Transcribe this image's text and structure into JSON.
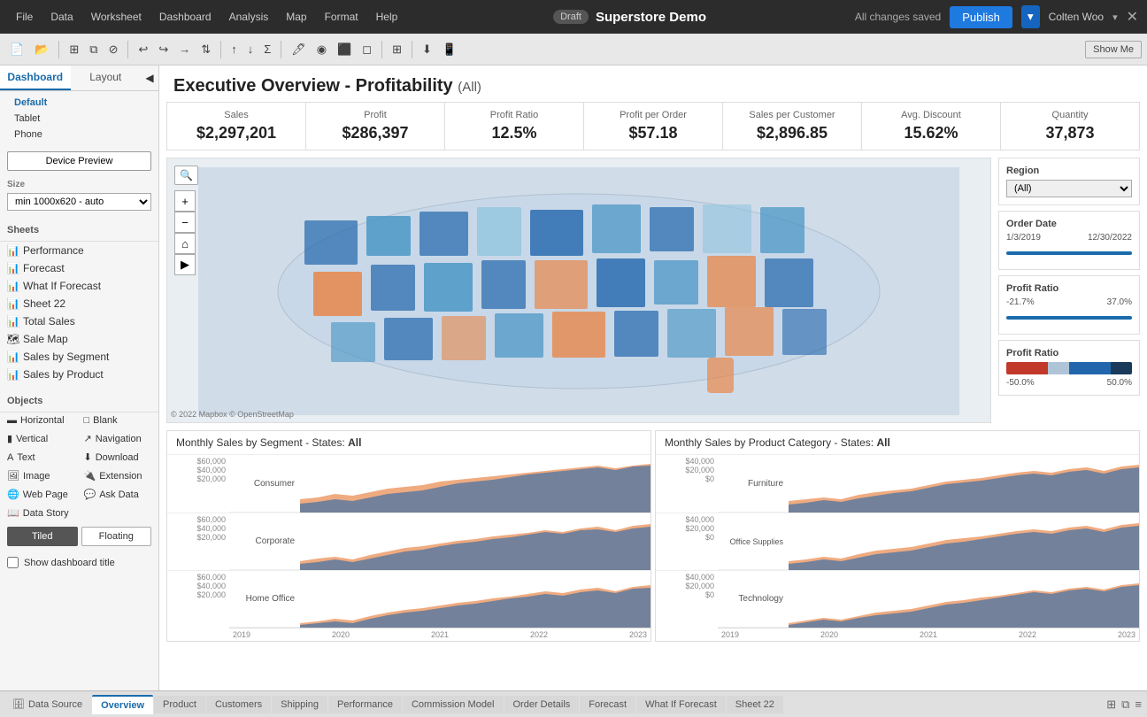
{
  "topbar": {
    "menu": [
      "File",
      "Data",
      "Worksheet",
      "Dashboard",
      "Analysis",
      "Map",
      "Format",
      "Help"
    ],
    "draft_label": "Draft",
    "title": "Superstore Demo",
    "saved_text": "All changes saved",
    "publish_label": "Publish",
    "user_name": "Colten Woo",
    "show_me_label": "Show Me"
  },
  "sidebar": {
    "tab_dashboard": "Dashboard",
    "tab_layout": "Layout",
    "device_preview_label": "Device Preview",
    "size_label": "Size",
    "size_value": "min 1000x620 - auto",
    "preview_options": [
      "Default",
      "Tablet",
      "Phone"
    ],
    "sheets_label": "Sheets",
    "sheets": [
      "Performance",
      "Forecast",
      "What If Forecast",
      "Sheet 22",
      "Total Sales",
      "Sale Map",
      "Sales by Segment",
      "Sales by Product"
    ],
    "objects_label": "Objects",
    "objects": [
      {
        "label": "Horizontal",
        "col": 1
      },
      {
        "label": "Blank",
        "col": 2
      },
      {
        "label": "Vertical",
        "col": 1
      },
      {
        "label": "Navigation",
        "col": 2
      },
      {
        "label": "Text",
        "col": 1
      },
      {
        "label": "Download",
        "col": 2
      },
      {
        "label": "Image",
        "col": 1
      },
      {
        "label": "Extension",
        "col": 2
      },
      {
        "label": "Web Page",
        "col": 1
      },
      {
        "label": "Ask Data",
        "col": 2
      },
      {
        "label": "Data Story",
        "col": 1
      }
    ],
    "tiled_label": "Tiled",
    "floating_label": "Floating",
    "show_title_label": "Show dashboard title"
  },
  "dashboard": {
    "title": "Executive Overview - Profitability",
    "title_suffix": "(All)",
    "kpis": [
      {
        "label": "Sales",
        "value": "$2,297,201"
      },
      {
        "label": "Profit",
        "value": "$286,397"
      },
      {
        "label": "Profit Ratio",
        "value": "12.5%"
      },
      {
        "label": "Profit per Order",
        "value": "$57.18"
      },
      {
        "label": "Sales per Customer",
        "value": "$2,896.85"
      },
      {
        "label": "Avg. Discount",
        "value": "15.62%"
      },
      {
        "label": "Quantity",
        "value": "37,873"
      }
    ],
    "region_label": "Region",
    "region_value": "(All)",
    "order_date_label": "Order Date",
    "order_date_start": "1/3/2019",
    "order_date_end": "12/30/2022",
    "profit_ratio_label": "Profit Ratio",
    "profit_ratio_min": "-21.7%",
    "profit_ratio_max": "37.0%",
    "profit_ratio_label2": "Profit Ratio",
    "profit_ratio_scale_min": "-50.0%",
    "profit_ratio_scale_max": "50.0%",
    "map_copyright": "© 2022 Mapbox  © OpenStreetMap",
    "charts_left_title": "Monthly Sales by Segment - States: ",
    "charts_left_state": "All",
    "charts_right_title": "Monthly Sales by Product Category - States: ",
    "charts_right_state": "All",
    "left_segments": [
      "Consumer",
      "Corporate",
      "Home Office"
    ],
    "right_segments": [
      "Furniture",
      "Office Supplies",
      "Technology"
    ],
    "x_axis_years": [
      "2019",
      "2020",
      "2021",
      "2022",
      "2023"
    ],
    "y_labels_left": [
      "$60,000",
      "$40,000",
      "$20,000"
    ],
    "y_labels_right_furniture": [
      "$40,000",
      "$20,000",
      "$0"
    ],
    "y_labels_right_office": [
      "$40,000",
      "$20,000",
      "$0"
    ],
    "y_labels_right_tech": [
      "$40,000",
      "$20,000",
      "$0"
    ]
  },
  "bottom_tabs": {
    "datasource": "Data Source",
    "tabs": [
      "Overview",
      "Product",
      "Customers",
      "Shipping",
      "Performance",
      "Commission Model",
      "Order Details",
      "Forecast",
      "What If Forecast",
      "Sheet 22"
    ]
  }
}
